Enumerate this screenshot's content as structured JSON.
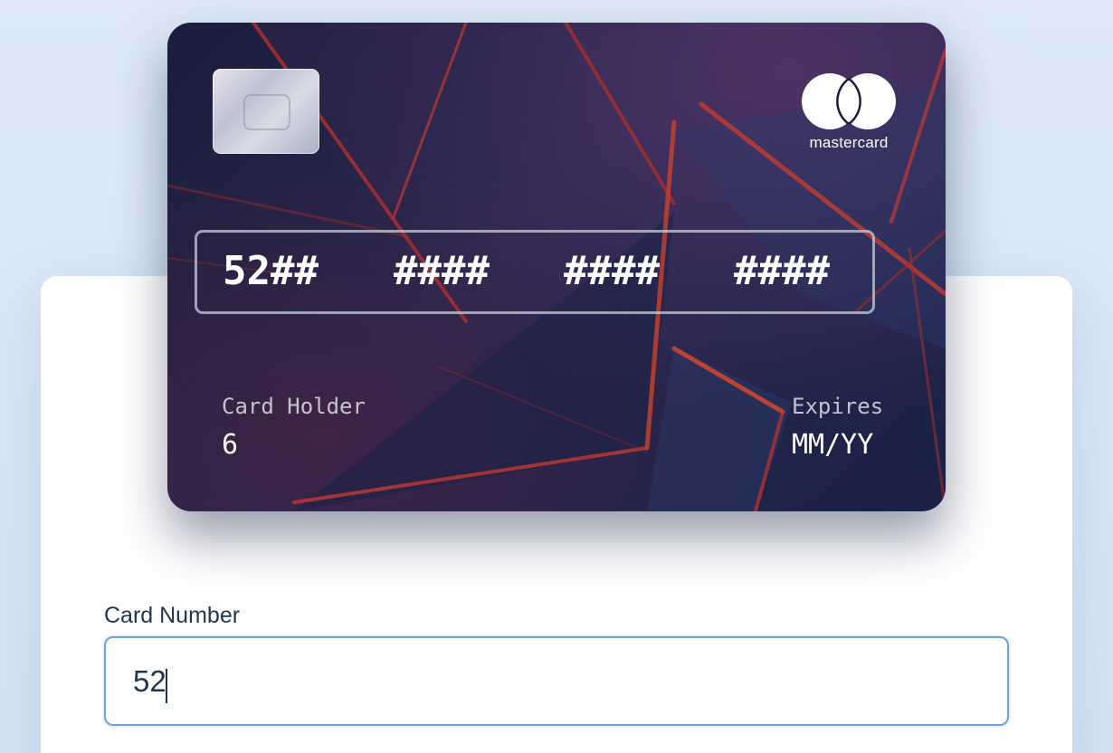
{
  "card": {
    "brand": "mastercard",
    "number_groups": [
      "52##",
      "####",
      "####",
      "####"
    ],
    "holder_label": "Card Holder",
    "holder_value": "6",
    "expires_label": "Expires",
    "expires_value": "MM/YY"
  },
  "form": {
    "card_number_label": "Card Number",
    "card_number_value": "52"
  },
  "colors": {
    "page_background": "#dde9f8",
    "card_background": "#1b1d3c",
    "input_border_focus": "#6aa3dc",
    "label_text": "#1f3650"
  },
  "icons": {
    "brand_logo": "mastercard-logo-icon",
    "chip": "card-chip-icon"
  }
}
